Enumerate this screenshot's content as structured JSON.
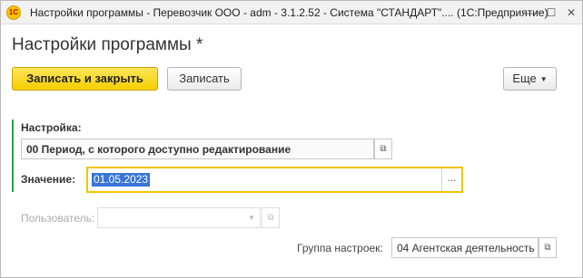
{
  "window": {
    "title": "Настройки программы - Перевозчик ООО - adm - 3.1.2.52 - Система \"СТАНДАРТ\".... (1С:Предприятие)",
    "logo_text": "1С",
    "min_icon": "minimize-icon",
    "max_icon": "maximize-icon",
    "close_icon": "close-icon",
    "min_glyph": "—",
    "max_glyph": "☐",
    "close_glyph": "✕"
  },
  "header": {
    "title": "Настройки программы *"
  },
  "toolbar": {
    "save_close_label": "Записать и закрыть",
    "save_label": "Записать",
    "more_label": "Еще",
    "more_arrow": "▼"
  },
  "form": {
    "setting_label": "Настройка:",
    "setting_value": "00 Период, с которого доступно редактирование",
    "value_label": "Значение:",
    "value": "01.05.2023",
    "value_button": "...",
    "user_label": "Пользователь:",
    "user_value": "",
    "user_dropdown_arrow": "▼",
    "group_label": "Группа настроек:",
    "group_value": "04 Агентская деятельность",
    "open_glyph": "⧉"
  },
  "colors": {
    "primary_button": "#f5cf00",
    "group_bar": "#2e9d4b",
    "focus_border": "#f3c400",
    "selection": "#3875d7"
  }
}
